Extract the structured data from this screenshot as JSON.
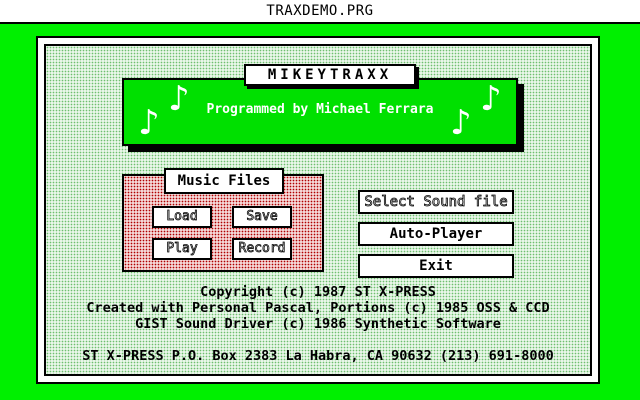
{
  "window": {
    "title": "TRAXDEMO.PRG"
  },
  "app": {
    "title": "MIKEYTRAXX",
    "credit": "Programmed by Michael Ferrara"
  },
  "music_files": {
    "title": "Music Files",
    "buttons": {
      "load": "Load",
      "save": "Save",
      "play": "Play",
      "record": "Record"
    }
  },
  "actions": {
    "select_sound_file": "Select Sound file",
    "auto_player": "Auto-Player",
    "exit": "Exit"
  },
  "credits": {
    "line1": "Copyright (c) 1987 ST X-PRESS",
    "line2": "Created with Personal Pascal, Portions (c) 1985 OSS & CCD",
    "line3": "GIST Sound Driver (c) 1986 Synthetic Software",
    "address": "ST X-PRESS  P.O. Box 2383  La Habra, CA 90632  (213) 691-8000"
  },
  "icons": {
    "note": "♪",
    "note_names": [
      "music-note-icon"
    ]
  },
  "colors": {
    "desktop": "#00f000",
    "banner": "#00e000",
    "music_box": "#b00000"
  }
}
